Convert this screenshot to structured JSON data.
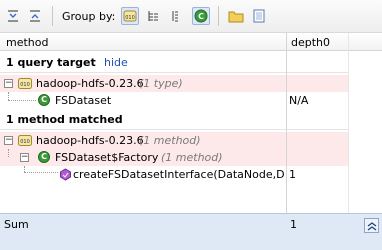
{
  "toolbar": {
    "group_by_label": "Group by:",
    "buttons": [
      {
        "icon": "expand-all-icon"
      },
      {
        "icon": "collapse-all-icon"
      },
      {
        "icon": "group-by-module-icon",
        "active": true
      },
      {
        "icon": "group-by-package-icon"
      },
      {
        "icon": "group-by-hierarchy-icon"
      },
      {
        "icon": "group-by-class-icon",
        "active": true
      },
      {
        "icon": "folder-icon"
      },
      {
        "icon": "file-icon"
      }
    ]
  },
  "columns": {
    "method": "method",
    "depth": "depth0"
  },
  "sections": {
    "query_target": {
      "title": "1 query target",
      "hide_link": "hide",
      "module": "hadoop-hdfs-0.23.6",
      "module_meta": "(1 type)",
      "class": "FSDataset",
      "class_value": "N/A"
    },
    "method_matched": {
      "title": "1 method matched",
      "module": "hadoop-hdfs-0.23.6",
      "module_meta": "(1 method)",
      "class": "FSDataset$Factory",
      "class_meta": "(1 method)",
      "method": "createFSDatasetInterface(DataNode,DataS",
      "method_value": "1"
    }
  },
  "footer": {
    "sum_label": "Sum",
    "sum_value": "1"
  },
  "colors": {
    "row_highlight": "#fde9ea",
    "link": "#1f4fb5",
    "class_icon": "#3a9a3a",
    "footer_bg": "#dfe8f5"
  }
}
